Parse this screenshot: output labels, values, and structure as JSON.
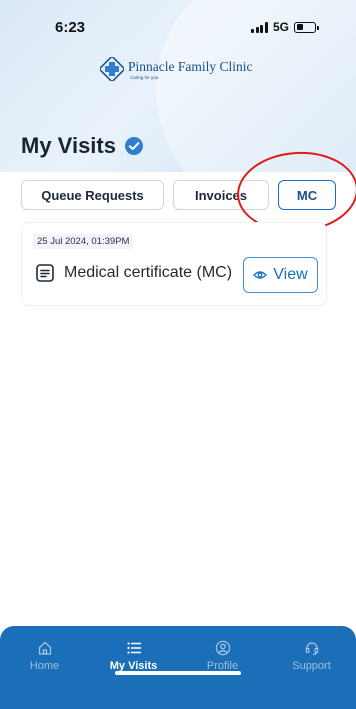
{
  "status_bar": {
    "time": "6:23",
    "network": "5G"
  },
  "logo": {
    "name": "Pinnacle Family Clinic",
    "tagline": "Caring for you"
  },
  "page": {
    "title": "My Visits"
  },
  "tabs": [
    {
      "label": "Queue Requests"
    },
    {
      "label": "Invoices"
    },
    {
      "label": "MC",
      "active": true
    }
  ],
  "records": [
    {
      "date": "25 Jul 2024, 01:39PM",
      "title": "Medical certificate (MC)",
      "action_label": "View"
    }
  ],
  "bottom_nav": [
    {
      "label": "Home",
      "icon": "home-icon"
    },
    {
      "label": "My Visits",
      "icon": "list-icon",
      "active": true
    },
    {
      "label": "Profile",
      "icon": "profile-icon"
    },
    {
      "label": "Support",
      "icon": "headset-icon"
    }
  ],
  "colors": {
    "primary": "#1b6fb8",
    "accent": "#1b4f8a",
    "verified": "#2f7fd1",
    "annotation": "#e01b1b"
  }
}
